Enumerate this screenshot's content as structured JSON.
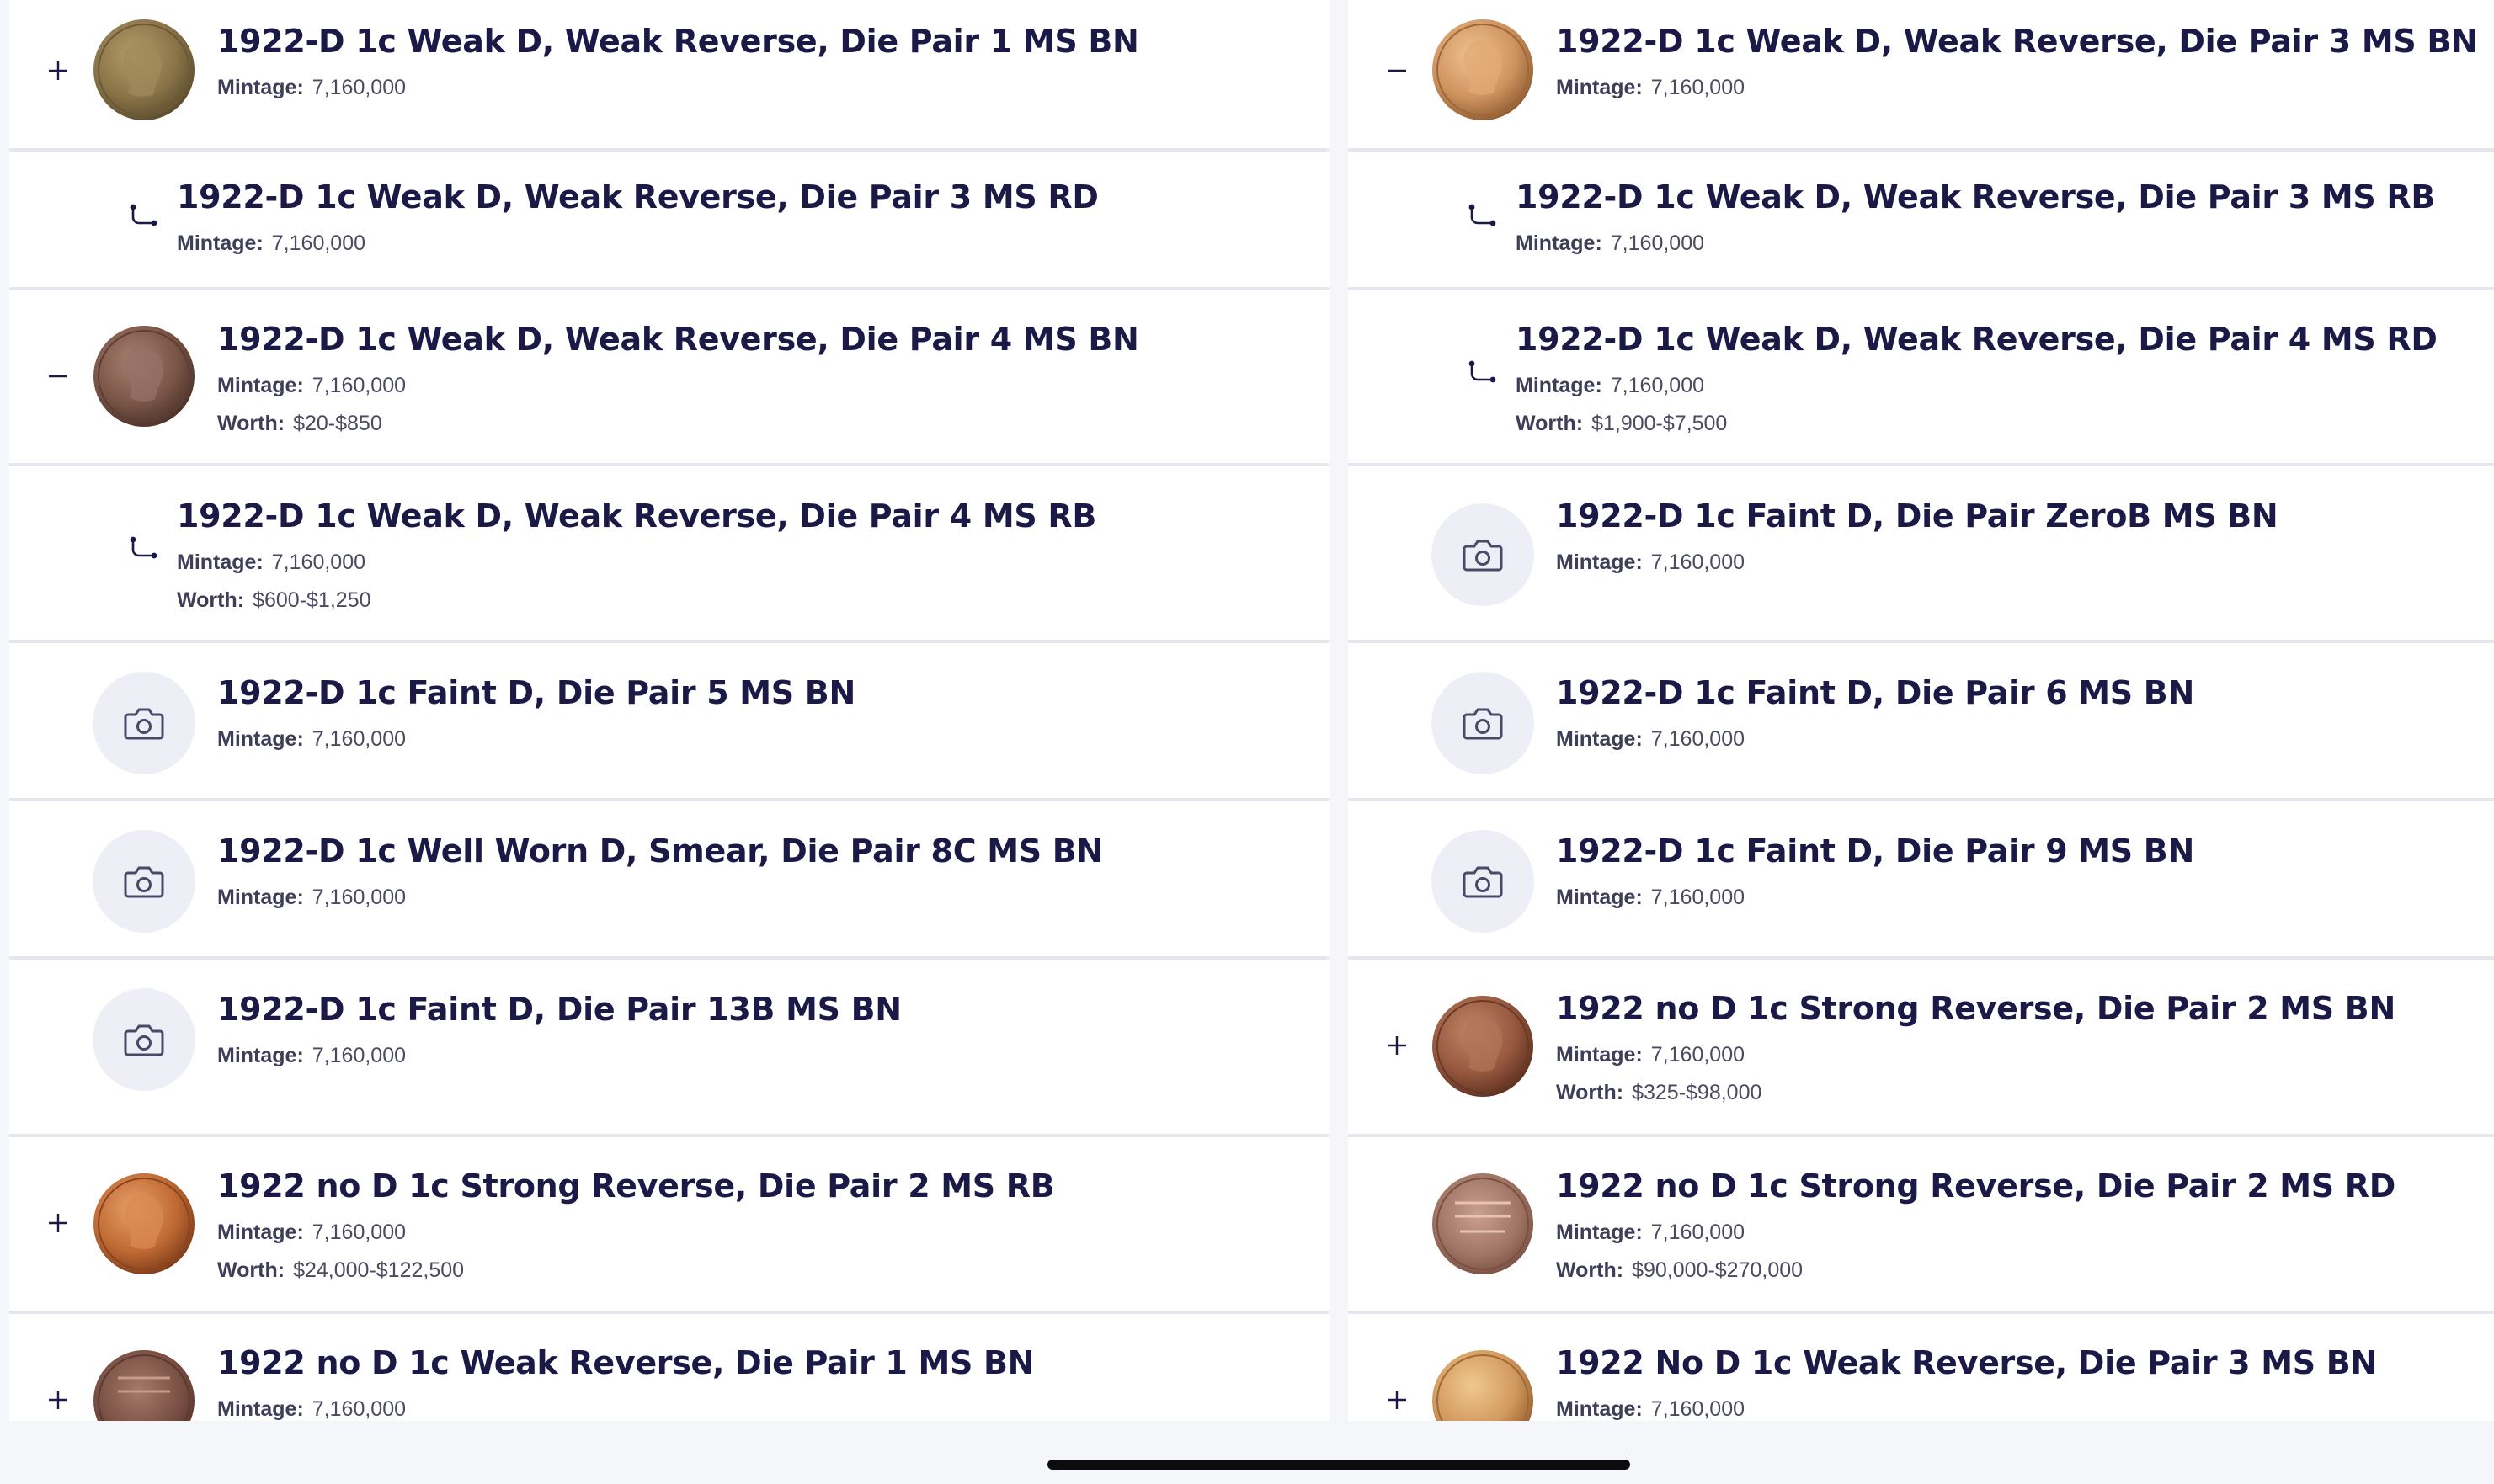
{
  "colors": {
    "title": "#1b1a47",
    "label": "#3d3e58",
    "value": "#4a4b60",
    "divider": "#e6e7ec",
    "row_bg": "#ffffff",
    "camera_bg": "#eeeef6",
    "page_bg": "#f5f6fa"
  },
  "labels": {
    "mintage": "Mintage:",
    "worth": "Worth:"
  },
  "left_column": {
    "rows": [
      {
        "title": "1922-D 1c Weak D, Weak Reverse, Die Pair 1 MS BN",
        "mintage": "7,160,000",
        "expander": "plus-icon",
        "media": "coin-photo"
      },
      {
        "title": "1922-D 1c Weak D, Weak Reverse, Die Pair 3 MS RD",
        "mintage": "7,160,000",
        "media": "sub-variety-icon"
      },
      {
        "title": "1922-D 1c Weak D, Weak Reverse, Die Pair 4 MS BN",
        "mintage": "7,160,000",
        "worth": "$20-$850",
        "expander": "minus-icon",
        "media": "coin-photo"
      },
      {
        "title": "1922-D 1c Weak D, Weak Reverse, Die Pair 4 MS RB",
        "mintage": "7,160,000",
        "worth": "$600-$1,250",
        "media": "sub-variety-icon"
      },
      {
        "title": "1922-D 1c Faint D, Die Pair 5 MS BN",
        "mintage": "7,160,000",
        "media": "camera-icon"
      },
      {
        "title": "1922-D 1c Well Worn D, Smear, Die Pair 8C MS BN",
        "mintage": "7,160,000",
        "media": "camera-icon"
      },
      {
        "title": "1922-D 1c Faint D, Die Pair 13B MS BN",
        "mintage": "7,160,000",
        "media": "camera-icon"
      },
      {
        "title": "1922 no D 1c Strong Reverse, Die Pair 2 MS RB",
        "mintage": "7,160,000",
        "worth": "$24,000-$122,500",
        "expander": "plus-icon",
        "media": "coin-photo"
      },
      {
        "title": "1922 no D 1c Weak Reverse, Die Pair 1 MS BN",
        "mintage": "7,160,000",
        "expander": "plus-icon",
        "media": "coin-photo"
      }
    ]
  },
  "right_column": {
    "rows": [
      {
        "title": "1922-D 1c Weak D, Weak Reverse, Die Pair 3 MS BN",
        "mintage": "7,160,000",
        "expander": "minus-icon",
        "media": "coin-photo"
      },
      {
        "title": "1922-D 1c Weak D, Weak Reverse, Die Pair 3 MS RB",
        "mintage": "7,160,000",
        "media": "sub-variety-icon"
      },
      {
        "title": "1922-D 1c Weak D, Weak Reverse, Die Pair 4 MS RD",
        "mintage": "7,160,000",
        "worth": "$1,900-$7,500",
        "media": "sub-variety-icon"
      },
      {
        "title": "1922-D 1c Faint D, Die Pair ZeroB MS BN",
        "mintage": "7,160,000",
        "media": "camera-icon"
      },
      {
        "title": "1922-D 1c Faint D, Die Pair 6 MS BN",
        "mintage": "7,160,000",
        "media": "camera-icon"
      },
      {
        "title": "1922-D 1c Faint D, Die Pair 9 MS BN",
        "mintage": "7,160,000",
        "media": "camera-icon"
      },
      {
        "title": "1922 no D 1c Strong Reverse, Die Pair 2 MS BN",
        "mintage": "7,160,000",
        "worth": "$325-$98,000",
        "expander": "plus-icon",
        "media": "coin-photo"
      },
      {
        "title": "1922 no D 1c Strong Reverse, Die Pair 2 MS RD",
        "mintage": "7,160,000",
        "worth": "$90,000-$270,000",
        "media": "coin-photo"
      },
      {
        "title": "1922 No D 1c Weak Reverse, Die Pair 3 MS BN",
        "mintage": "7,160,000",
        "expander": "plus-icon",
        "media": "coin-photo"
      }
    ]
  }
}
